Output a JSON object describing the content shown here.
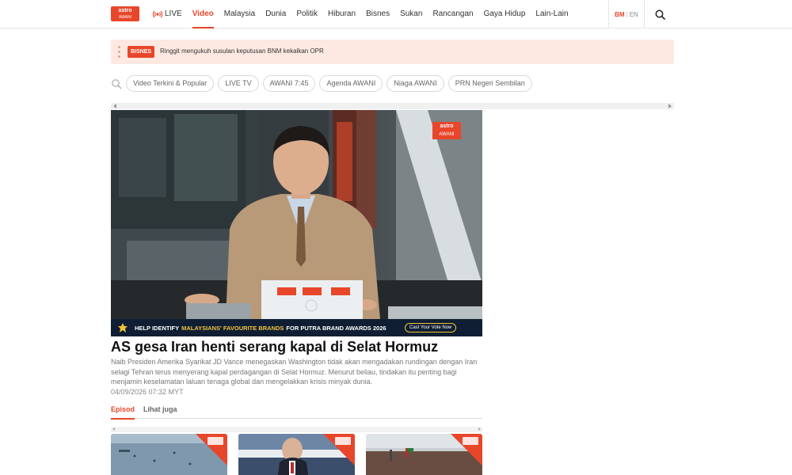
{
  "header": {
    "logo_line1": "astro",
    "logo_line2": "AWANI",
    "nav": [
      {
        "label": "LIVE",
        "icon": "live-broadcast-icon"
      },
      {
        "label": "Video",
        "active": true
      },
      {
        "label": "Malaysia"
      },
      {
        "label": "Dunia"
      },
      {
        "label": "Politik"
      },
      {
        "label": "Hiburan"
      },
      {
        "label": "Bisnes"
      },
      {
        "label": "Sukan"
      },
      {
        "label": "Rancangan"
      },
      {
        "label": "Gaya Hidup"
      },
      {
        "label": "Lain-Lain"
      }
    ],
    "lang_bm": "BM",
    "lang_sep": "|",
    "lang_en": "EN",
    "search_icon": "search-icon"
  },
  "ticker": {
    "badge": "BISNES",
    "text": "Ringgit mengukuh susulan keputusan BNM kekalkan OPR"
  },
  "chips": [
    "Video Terkini & Popular",
    "LIVE TV",
    "AWANI 7:45",
    "Agenda AWANI",
    "Niaga AWANI",
    "PRN Negeri Sembilan"
  ],
  "video": {
    "watermark_line1": "astro",
    "watermark_line2": "AWANI",
    "laptop_sticker": "astro",
    "ad_pre": "HELP IDENTIFY",
    "ad_highlight": "MALAYSIANS' FAVOURITE BRANDS",
    "ad_post": "FOR PUTRA BRAND AWARDS 2026",
    "ad_cta": "Cast Your Vote Now"
  },
  "article": {
    "headline": "AS gesa Iran henti serang kapal di Selat Hormuz",
    "summary": "Naib Presiden Amerika Syarikat JD Vance menegaskan Washington tidak akan mengadakan rundingan dengan Iran selagi Tehran terus menyerang kapal perdagangan di Selat Hormuz. Menurut beliau, tindakan itu penting bagi menjamin keselamatan laluan tenaga global dan mengelakkan krisis minyak dunia.",
    "timestamp": "04/09/2026 07:32 MYT"
  },
  "tabs": [
    "Episod",
    "Lihat juga"
  ],
  "colors": {
    "accent": "#e8462a",
    "ticker_bg": "#fde9e2",
    "ad_bg": "#0f1e33",
    "ad_highlight": "#f2c23b"
  }
}
